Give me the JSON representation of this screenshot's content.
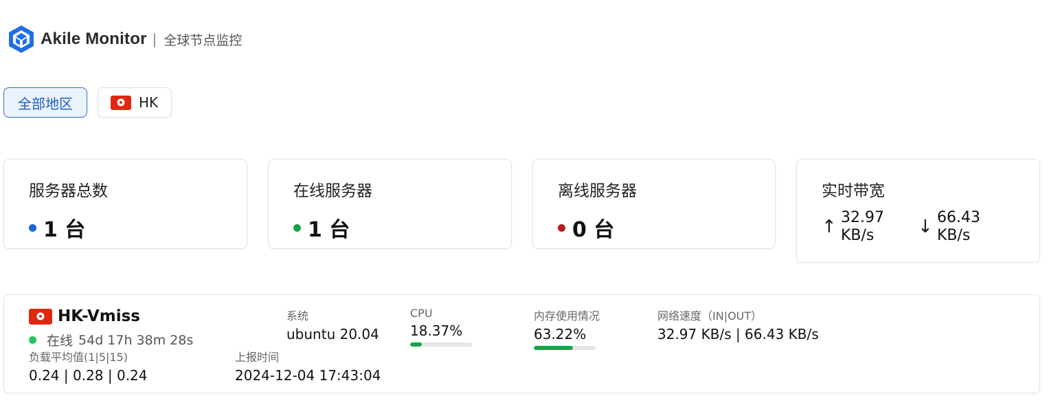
{
  "header": {
    "app_title": "Akile Monitor",
    "separator": "|",
    "subtitle": "全球节点监控"
  },
  "filters": [
    {
      "label": "全部地区",
      "active": true
    },
    {
      "label": "HK",
      "flag": "hong-kong-flag",
      "active": false
    }
  ],
  "stats": {
    "total": {
      "title": "服务器总数",
      "value": "1 台",
      "dot_color": "#1a66e0"
    },
    "online": {
      "title": "在线服务器",
      "value": "1 台",
      "dot_color": "#16a34a"
    },
    "offline": {
      "title": "离线服务器",
      "value": "0 台",
      "dot_color": "#b91c1c"
    },
    "bandwidth": {
      "title": "实时带宽",
      "up_icon": "arrow-up-icon",
      "down_icon": "arrow-down-icon",
      "up_value": "32.97",
      "up_unit": "KB/s",
      "down_value": "66.43",
      "down_unit": "KB/s"
    }
  },
  "server": {
    "name": "HK-Vmiss",
    "flag": "hong-kong-flag",
    "status": "在线",
    "uptime": "54d 17h 38m 28s",
    "status_color": "#22c55e",
    "os_label": "系统",
    "os_value": "ubuntu 20.04",
    "cpu_label": "CPU",
    "cpu_value": "18.37%",
    "cpu_fraction": 0.1837,
    "mem_label": "内存使用情况",
    "mem_value": "63.22%",
    "mem_fraction": 0.6322,
    "net_label": "网络速度（IN|OUT）",
    "net_value": "32.97 KB/s | 66.43 KB/s",
    "load_label": "负载平均值(1|5|15)",
    "load_value": "0.24 | 0.28 | 0.24",
    "report_label": "上报时间",
    "report_value": "2024-12-04 17:43:04"
  },
  "colors": {
    "accent": "#1d5fbf",
    "progress": "#17a34a",
    "flag_red": "#de2910"
  }
}
